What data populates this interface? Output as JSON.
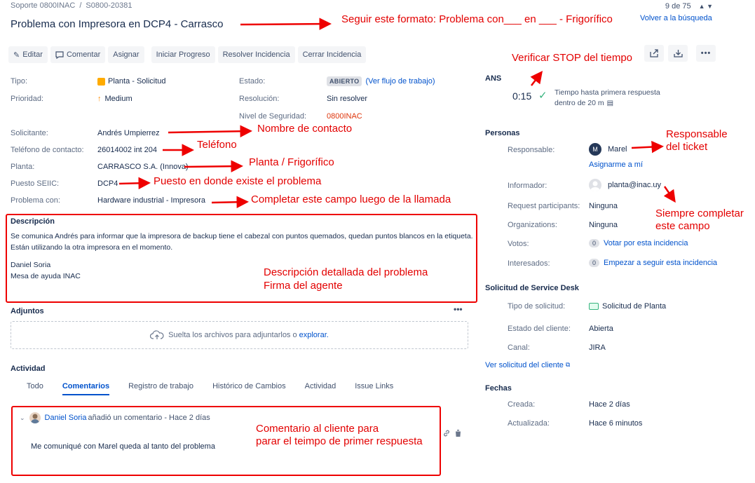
{
  "breadcrumb": {
    "project": "Soporte 0800INAC",
    "issue_key": "S0800-20381"
  },
  "issue_title": "Problema con Impresora en DCP4 - Carrasco",
  "pager": {
    "position": "9 de 75",
    "back_link": "Volver a la búsqueda"
  },
  "toolbar": {
    "edit": "Editar",
    "comment": "Comentar",
    "assign": "Asignar",
    "start_progress": "Iniciar Progreso",
    "resolve": "Resolver Incidencia",
    "close": "Cerrar Incidencia"
  },
  "fields": {
    "type_label": "Tipo:",
    "type_value": "Planta - Solicitud",
    "priority_label": "Prioridad:",
    "priority_value": "Medium",
    "status_label": "Estado:",
    "status_value": "ABIERTO",
    "workflow_link": "(Ver flujo de trabajo)",
    "resolution_label": "Resolución:",
    "resolution_value": "Sin resolver",
    "security_label": "Nivel de Seguridad:",
    "security_value": "0800INAC",
    "requester_label": "Solicitante:",
    "requester_value": "Andrés Umpierrez",
    "phone_label": "Teléfono de contacto:",
    "phone_value": "26014002 int 204",
    "plant_label": "Planta:",
    "plant_value": "CARRASCO S.A. (Innova)",
    "post_label": "Puesto SEIIC:",
    "post_value": "DCP4",
    "problem_label": "Problema con:",
    "problem_value": "Hardware industrial - Impresora"
  },
  "description": {
    "heading": "Descripción",
    "line1": "Se comunica Andrés para informar que la impresora de backup tiene el cabezal con puntos quemados, quedan puntos blancos en la etiqueta.",
    "line2": "Están utilizando la otra impresora en el momento.",
    "line3": "Daniel Soria",
    "line4": "Mesa de ayuda INAC"
  },
  "attachments": {
    "heading": "Adjuntos",
    "drop_text": "Suelta los archivos para adjuntarlos o",
    "browse": "explorar."
  },
  "activity": {
    "heading": "Actividad",
    "tabs": [
      "Todo",
      "Comentarios",
      "Registro de trabajo",
      "Histórico de Cambios",
      "Actividad",
      "Issue Links"
    ],
    "comment_author": "Daniel Soria",
    "comment_meta": "añadió un comentario - Hace 2 días",
    "comment_body": "Me comuniqué con Marel queda al tanto del problema"
  },
  "sla": {
    "heading": "ANS",
    "time": "0:15",
    "label_line1": "Tiempo hasta primera respuesta",
    "label_line2": "dentro de 20 m"
  },
  "people": {
    "heading": "Personas",
    "assignee_label": "Responsable:",
    "assignee_initial": "M",
    "assignee_value": "Marel",
    "assign_me": "Asignarme a mí",
    "reporter_label": "Informador:",
    "reporter_value": "planta@inac.uy",
    "participants_label": "Request participants:",
    "participants_value": "Ninguna",
    "orgs_label": "Organizations:",
    "orgs_value": "Ninguna",
    "votes_label": "Votos:",
    "votes_count": "0",
    "votes_link": "Votar por esta incidencia",
    "watchers_label": "Interesados:",
    "watchers_count": "0",
    "watchers_link": "Empezar a seguir esta incidencia"
  },
  "service_desk": {
    "heading": "Solicitud de Service Desk",
    "req_type_label": "Tipo de solicitud:",
    "req_type_value": "Solicitud de Planta",
    "client_status_label": "Estado del cliente:",
    "client_status_value": "Abierta",
    "channel_label": "Canal:",
    "channel_value": "JIRA",
    "view_link": "Ver solicitud del cliente"
  },
  "dates": {
    "heading": "Fechas",
    "created_label": "Creada:",
    "created_value": "Hace 2 días",
    "updated_label": "Actualizada:",
    "updated_value": "Hace 6 minutos"
  },
  "annotations": {
    "title_format": "Seguir este formato: Problema con___ en ___ - Frigorífico",
    "verify_stop": "Verificar STOP del tiempo",
    "contact_name": "Nombre de contacto",
    "phone": "Teléfono",
    "plant": "Planta / Frigorífico",
    "post": "Puesto en donde existe el problema",
    "complete_after": "Completar este campo luego de la llamada",
    "responsible_1": "Responsable",
    "responsible_2": "del ticket",
    "always_1": "Siempre completar",
    "always_2": "este campo",
    "desc_1": "Descripción detallada del problema",
    "desc_2": "Firma del agente",
    "comment_1": "Comentario al cliente para",
    "comment_2": "parar el teimpo de primer respuesta"
  },
  "colors": {
    "annotation": "#e30000",
    "link": "#0052cc",
    "sla_ok": "#36b37e",
    "priority": "#ff8b00"
  }
}
